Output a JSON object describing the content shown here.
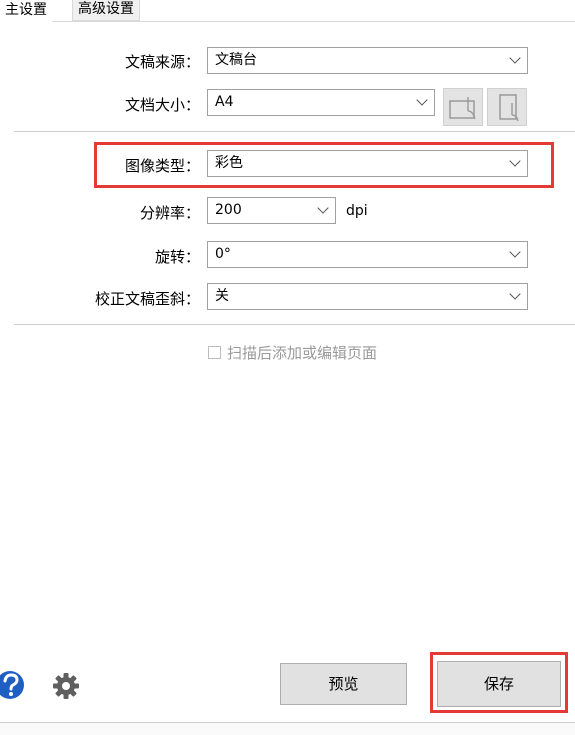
{
  "tabs": [
    {
      "label": "主设置"
    },
    {
      "label": "高级设置"
    }
  ],
  "form": {
    "source": {
      "label": "文稿来源：",
      "value": "文稿台"
    },
    "size": {
      "label": "文档大小：",
      "value": "A4"
    },
    "image_type": {
      "label": "图像类型：",
      "value": "彩色"
    },
    "resolution": {
      "label": "分辨率：",
      "value": "200",
      "unit": "dpi"
    },
    "rotate": {
      "label": "旋转：",
      "value": "0°"
    },
    "deskew": {
      "label": "校正文稿歪斜：",
      "value": "关"
    }
  },
  "checkbox": {
    "label": "扫描后添加或编辑页面",
    "checked": false
  },
  "buttons": {
    "preview": "预览",
    "save": "保存"
  },
  "icons": {
    "help": "help-icon",
    "settings": "gear-icon",
    "landscape": "page-landscape-icon",
    "portrait": "page-portrait-icon"
  },
  "colors": {
    "highlight": "#e53935",
    "help": "#1f5fc4",
    "gear": "#5f5f5f"
  }
}
